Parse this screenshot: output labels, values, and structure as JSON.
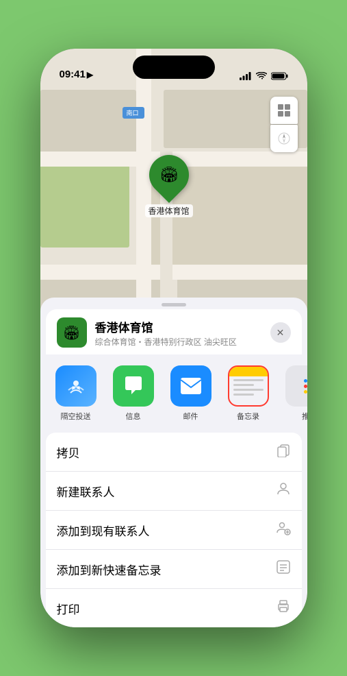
{
  "statusBar": {
    "time": "09:41",
    "locationIcon": "▶",
    "signalBars": "signal",
    "wifiIcon": "wifi",
    "batteryIcon": "battery"
  },
  "map": {
    "roadLabel": "南口",
    "pinLabel": "香港体育馆"
  },
  "placeSheet": {
    "placeName": "香港体育馆",
    "placeSub": "综合体育馆・香港特别行政区 油尖旺区",
    "closeLabel": "✕"
  },
  "shareItems": [
    {
      "id": "airdrop",
      "label": "隔空投送"
    },
    {
      "id": "messages",
      "label": "信息"
    },
    {
      "id": "mail",
      "label": "邮件"
    },
    {
      "id": "notes",
      "label": "备忘录"
    },
    {
      "id": "more",
      "label": "推"
    }
  ],
  "actionItems": [
    {
      "label": "拷贝",
      "icon": "copy"
    },
    {
      "label": "新建联系人",
      "icon": "person"
    },
    {
      "label": "添加到现有联系人",
      "icon": "person-add"
    },
    {
      "label": "添加到新快速备忘录",
      "icon": "note"
    },
    {
      "label": "打印",
      "icon": "print"
    }
  ]
}
